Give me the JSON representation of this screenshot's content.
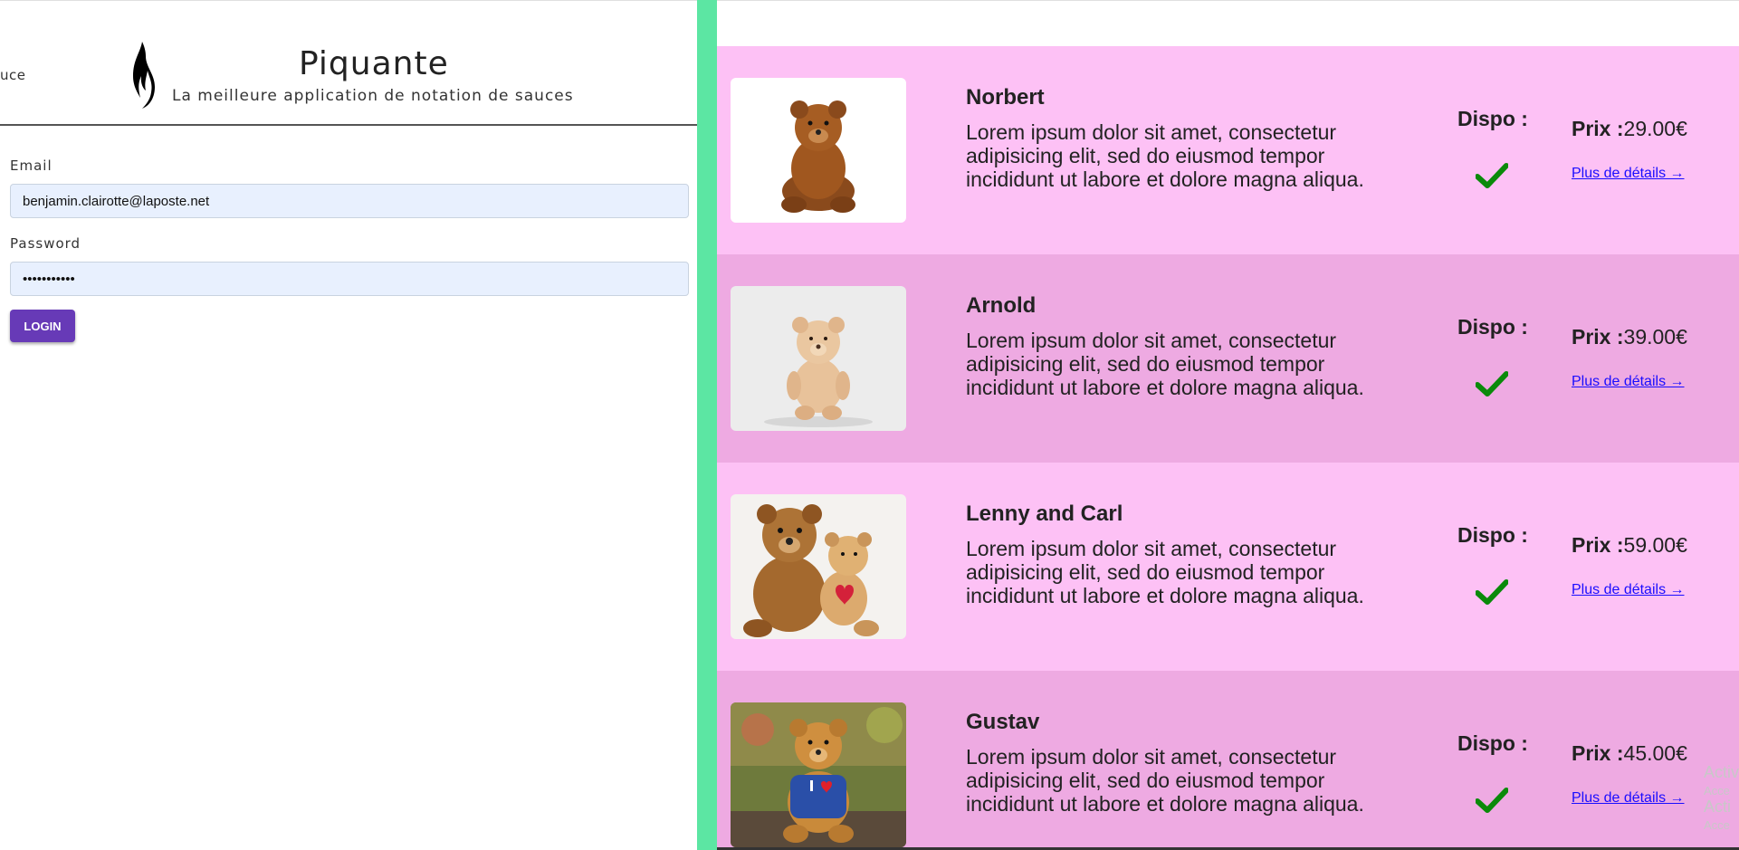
{
  "left": {
    "nav_cut_text": "uce",
    "brand": {
      "title": "Piquante",
      "subtitle": "La meilleure application de notation de sauces"
    },
    "form": {
      "email_label": "Email",
      "email_value": "benjamin.clairotte@laposte.net",
      "password_label": "Password",
      "password_value": "•••••••••••",
      "login_label": "LOGIN"
    },
    "colors": {
      "accent": "#673ab7",
      "divider": "#5ce6a3"
    }
  },
  "right": {
    "products": [
      {
        "name": "Norbert",
        "description": "Lorem ipsum dolor sit amet, consectetur adipisicing elit, sed do eiusmod tempor incididunt ut labore et dolore magna aliqua.",
        "dispo_label": "Dispo :",
        "available_icon": "check-icon",
        "price_label": "Prix :",
        "price_value": "29.00€",
        "details_label": "Plus de détails →",
        "image": "teddy-bear-brown"
      },
      {
        "name": "Arnold",
        "description": "Lorem ipsum dolor sit amet, consectetur adipisicing elit, sed do eiusmod tempor incididunt ut labore et dolore magna aliqua.",
        "dispo_label": "Dispo :",
        "available_icon": "check-icon",
        "price_label": "Prix :",
        "price_value": "39.00€",
        "details_label": "Plus de détails →",
        "image": "teddy-bear-beige"
      },
      {
        "name": "Lenny and Carl",
        "description": "Lorem ipsum dolor sit amet, consectetur adipisicing elit, sed do eiusmod tempor incididunt ut labore et dolore magna aliqua.",
        "dispo_label": "Dispo :",
        "available_icon": "check-icon",
        "price_label": "Prix :",
        "price_value": "59.00€",
        "details_label": "Plus de détails →",
        "image": "two-teddy-bears"
      },
      {
        "name": "Gustav",
        "description": "Lorem ipsum dolor sit amet, consectetur adipisicing elit, sed do eiusmod tempor incididunt ut labore et dolore magna aliqua.",
        "dispo_label": "Dispo :",
        "available_icon": "check-icon",
        "price_label": "Prix :",
        "price_value": "45.00€",
        "details_label": "Plus de détails →",
        "image": "teddy-bear-blue-shirt"
      }
    ],
    "row_colors": [
      "#fdc1f5",
      "#eeaae2"
    ],
    "check_color": "#0a8a0a",
    "link_color": "#1a0dff",
    "watermark": {
      "line1": "Activ",
      "line2": "Acce",
      "line3": "Acti",
      "line4": "Acce"
    }
  }
}
